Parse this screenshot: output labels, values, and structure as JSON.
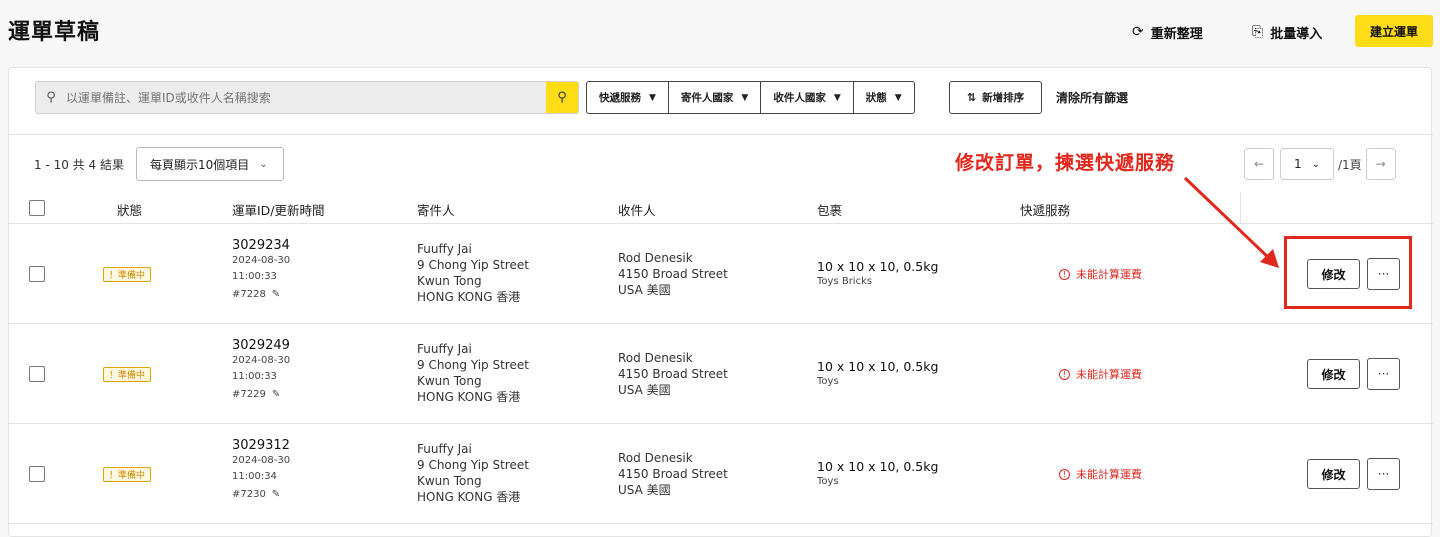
{
  "header": {
    "title": "運單草稿",
    "refresh_label": "重新整理",
    "import_label": "批量導入",
    "create_label": "建立運單"
  },
  "toolbar": {
    "search_placeholder": "以運單備註、運單ID或收件人名稱搜索",
    "filters": [
      "快遞服務",
      "寄件人國家",
      "收件人國家",
      "狀態"
    ],
    "sort_label": "新增排序",
    "clear_label": "清除所有篩選"
  },
  "list": {
    "range_text": "1 - 10 共 4 結果",
    "per_page": "每頁顯示10個項目",
    "page": "1",
    "total_pages": "/1頁"
  },
  "annotation": {
    "text": "修改訂單，揀選快遞服務",
    "color": "#e2271c"
  },
  "table": {
    "columns": [
      "狀態",
      "運單ID/更新時間",
      "寄件人",
      "收件人",
      "包裹",
      "快遞服務"
    ],
    "rows": [
      {
        "status": "！準備中",
        "id": "3029234",
        "date": "2024-08-30",
        "time": "11:00:33",
        "tag": "#7228",
        "sender": [
          "Fuuffy Jai",
          "9 Chong Yip Street",
          "Kwun Tong",
          "HONG KONG 香港"
        ],
        "receiver": [
          "Rod Denesik",
          "4150 Broad Street",
          "USA 美國"
        ],
        "dims": "10 x 10 x 10, 0.5kg",
        "desc": "Toys Bricks",
        "service": "未能計算運費",
        "edit": "修改",
        "more": "···"
      },
      {
        "status": "！準備中",
        "id": "3029249",
        "date": "2024-08-30",
        "time": "11:00:33",
        "tag": "#7229",
        "sender": [
          "Fuuffy Jai",
          "9 Chong Yip Street",
          "Kwun Tong",
          "HONG KONG 香港"
        ],
        "receiver": [
          "Rod Denesik",
          "4150 Broad Street",
          "USA 美國"
        ],
        "dims": "10 x 10 x 10, 0.5kg",
        "desc": "Toys",
        "service": "未能計算運費",
        "edit": "修改",
        "more": "···"
      },
      {
        "status": "！準備中",
        "id": "3029312",
        "date": "2024-08-30",
        "time": "11:00:34",
        "tag": "#7230",
        "sender": [
          "Fuuffy Jai",
          "9 Chong Yip Street",
          "Kwun Tong",
          "HONG KONG 香港"
        ],
        "receiver": [
          "Rod Denesik",
          "4150 Broad Street",
          "USA 美國"
        ],
        "dims": "10 x 10 x 10, 0.5kg",
        "desc": "Toys",
        "service": "未能計算運費",
        "edit": "修改",
        "more": "···"
      }
    ]
  },
  "icons": {
    "search": "search-icon",
    "refresh": "refresh-icon",
    "import": "file-upload-icon",
    "sort": "sort-icon",
    "pencil": "pencil-icon",
    "error": "alert-circle-icon"
  },
  "colors": {
    "accent": "#ffdc16",
    "warning": "#d08700",
    "error": "#e2271c"
  }
}
